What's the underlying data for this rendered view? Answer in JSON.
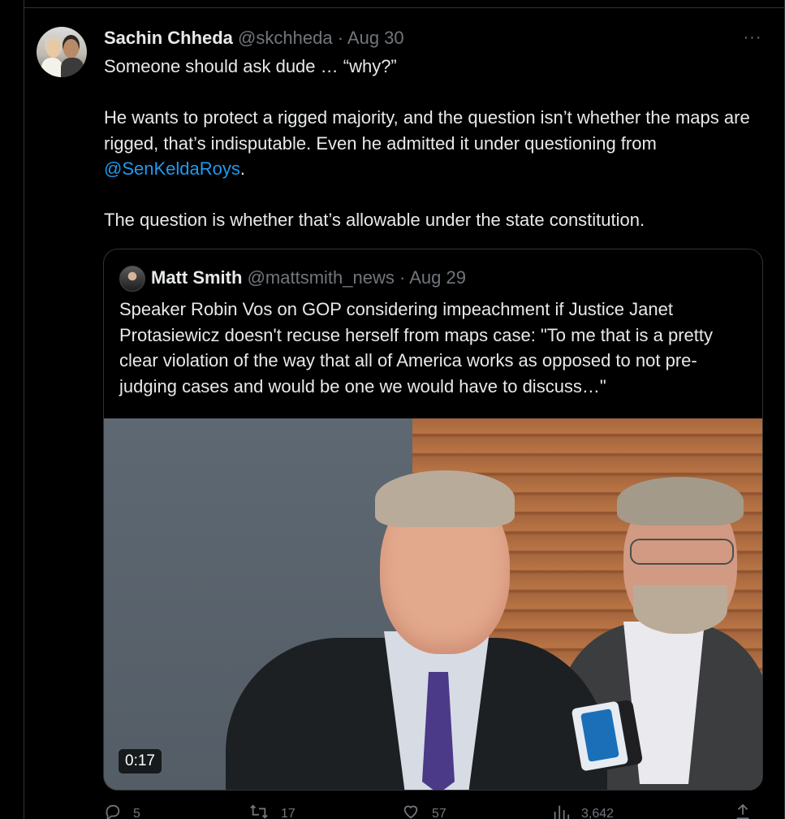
{
  "tweet": {
    "author_name": "Sachin Chheda",
    "author_handle": "@skchheda",
    "separator": "·",
    "date": "Aug 30",
    "more_label": "···",
    "line1": "Someone should ask dude … “why?”",
    "para2_text": "He wants to protect a rigged majority, and the question isn’t whether the maps are rigged, that’s indisputable. Even he admitted it under questioning from ",
    "para2_mention": "@SenKeldaRoys",
    "para2_end": ".",
    "para3": "The question is whether that’s allowable under the state constitution."
  },
  "quote": {
    "author_name": "Matt Smith",
    "author_handle": "@mattsmith_news",
    "separator": "·",
    "date": "Aug 29",
    "text": "Speaker Robin Vos on GOP considering impeachment if Justice Janet Protasiewicz doesn't recuse herself from maps case: \"To me that is a pretty clear violation of the way that all of America works as opposed to not pre-judging cases and would be one we would have to discuss…\"",
    "video_duration": "0:17"
  },
  "actions": {
    "reply": {
      "icon": "reply-icon",
      "count": "5"
    },
    "retweet": {
      "icon": "retweet-icon",
      "count": "17"
    },
    "like": {
      "icon": "like-icon",
      "count": "57"
    },
    "views": {
      "icon": "views-icon",
      "count": "3,642"
    },
    "share": {
      "icon": "share-icon"
    }
  },
  "colors": {
    "background": "#000000",
    "text": "#e7e9ea",
    "muted": "#71767b",
    "link": "#1d9bf0",
    "border": "#2f3336"
  }
}
